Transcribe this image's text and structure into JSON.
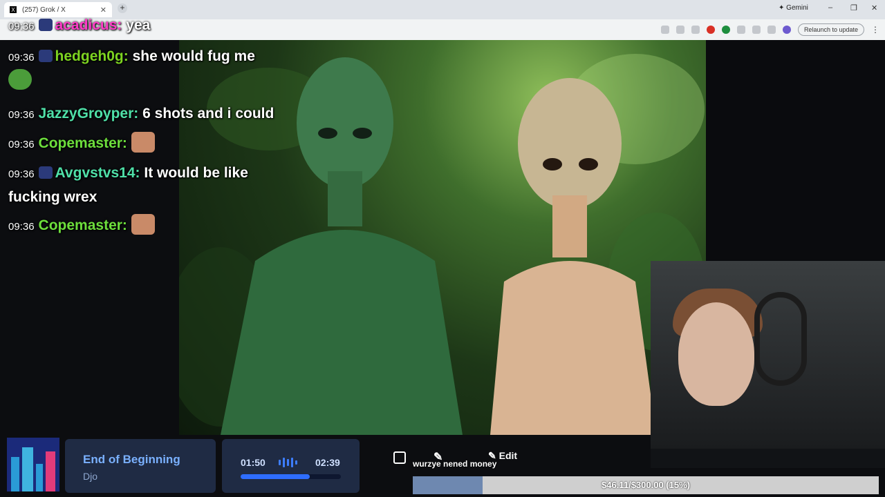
{
  "browser": {
    "tab_title": "(257) Grok / X",
    "gemini_label": "Gemini",
    "relaunch_label": "Relaunch to update"
  },
  "chat": {
    "messages": [
      {
        "time": "09:36",
        "user": "acadicus:",
        "text": "yea",
        "user_color": "#ff3cc8"
      },
      {
        "time": "09:36",
        "user": "hedgeh0g:",
        "text": "she would fug me",
        "user_color": "#7dd321"
      },
      {
        "time": "09:36",
        "user": "JazzyGroyper:",
        "text": "6 shots and i could",
        "user_color": "#4fe0a8"
      },
      {
        "time": "09:36",
        "user": "Copemaster:",
        "text": "",
        "user_color": "#6dde3c"
      },
      {
        "time": "09:36",
        "user": "Avgvstvs14:",
        "text": "It would be like fucking wrex",
        "user_color": "#4fe0a8"
      },
      {
        "time": "09:36",
        "user": "Copemaster:",
        "text": "",
        "user_color": "#6dde3c"
      }
    ]
  },
  "music": {
    "song": "End of Beginning",
    "artist": "Djo",
    "elapsed": "01:50",
    "total": "02:39",
    "progress": 0.69
  },
  "toolbar": {
    "edit_label": "Edit",
    "donation_text": "wurzye nened money"
  },
  "goal": {
    "text": "$46.11/$300.00 (15%)",
    "progress": 0.15
  },
  "colors": {
    "accent": "#2e6dff",
    "goal_fill": "#6e88b0"
  }
}
